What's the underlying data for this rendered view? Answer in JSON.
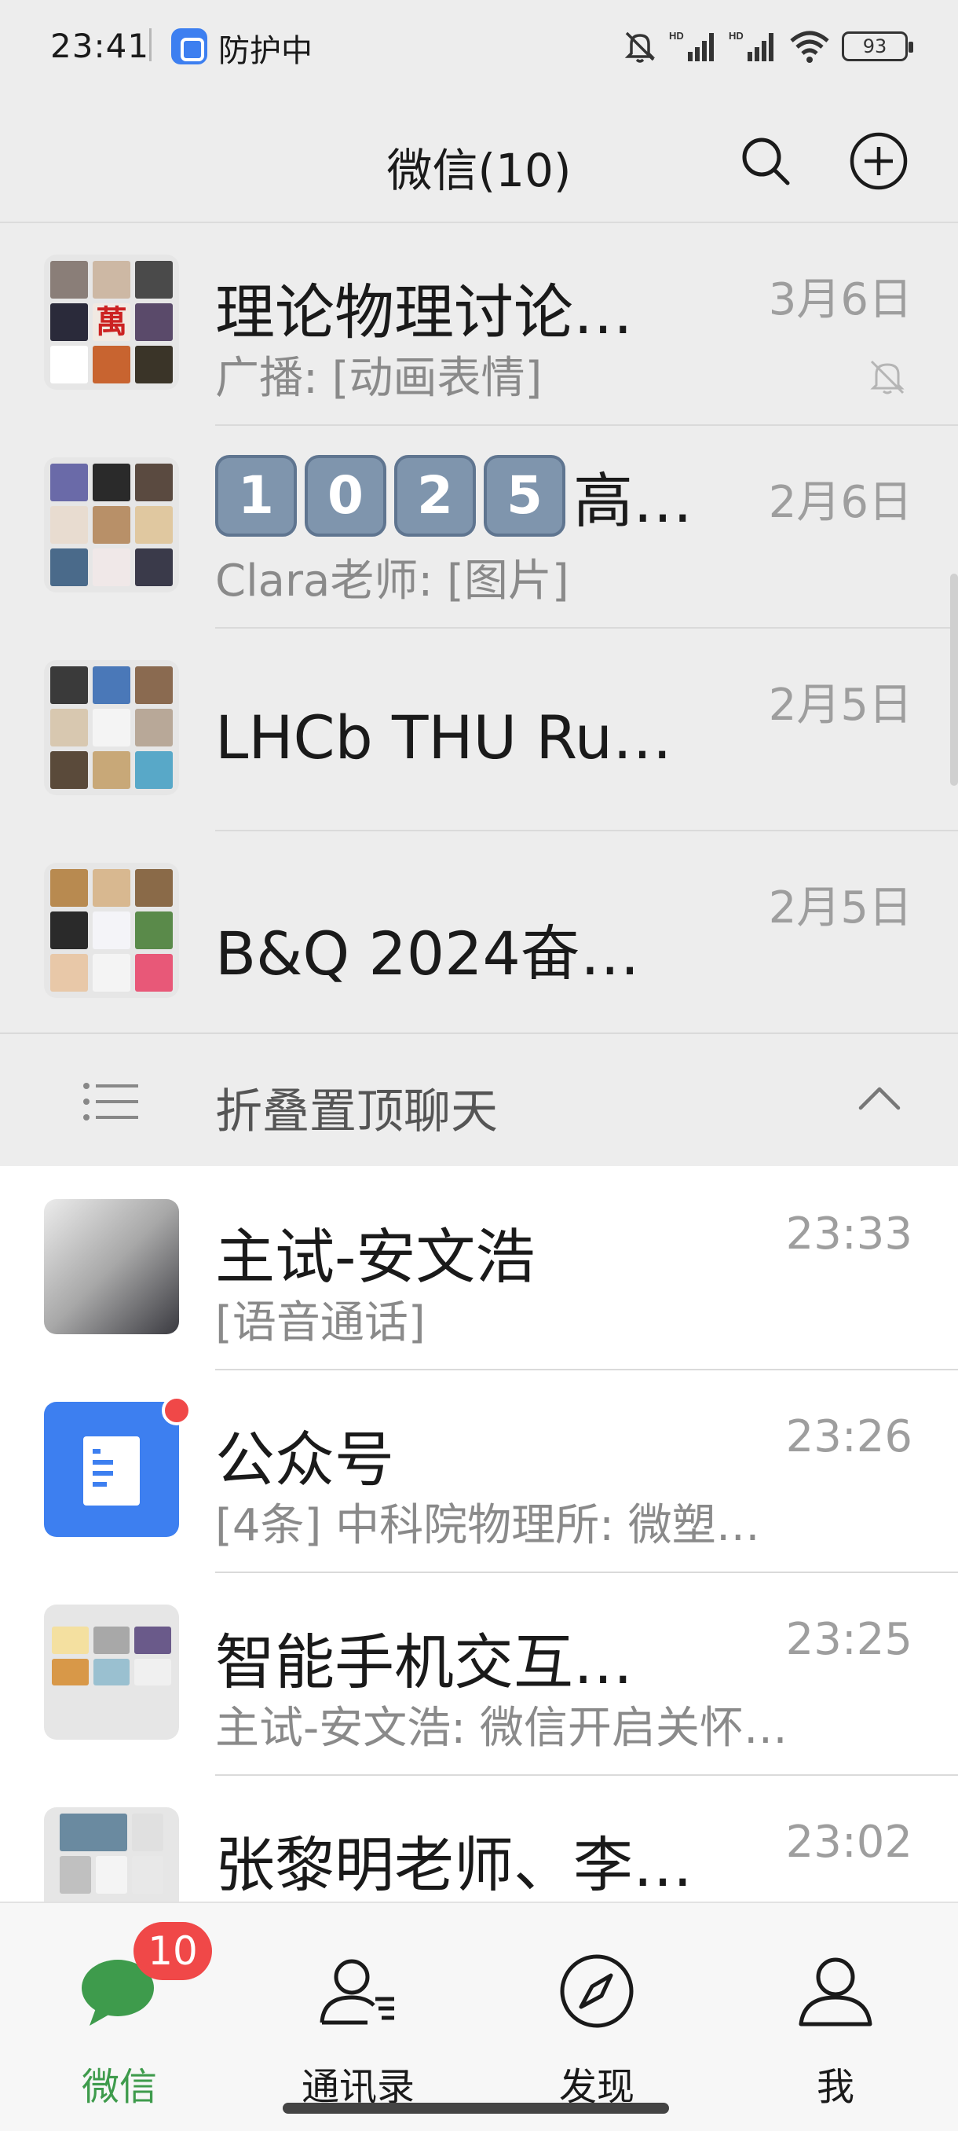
{
  "status_bar": {
    "time": "23:41",
    "protection": "防护中",
    "battery": "93"
  },
  "header": {
    "title": "微信(10)"
  },
  "pinned_chats": [
    {
      "name": "理论物理讨论…",
      "preview": "广播: [动画表情]",
      "time": "3月6日",
      "muted": true
    },
    {
      "name_keycaps": [
        "1",
        "0",
        "2",
        "5"
      ],
      "name_suffix": "高…",
      "preview": "Clara老师: [图片]",
      "time": "2月6日"
    },
    {
      "name": "LHCb THU Ru…",
      "preview": "",
      "time": "2月5日"
    },
    {
      "name": "B&Q 2024奋…",
      "preview": "",
      "time": "2月5日"
    }
  ],
  "fold_bar": {
    "label": "折叠置顶聊天"
  },
  "chats": [
    {
      "name": "主试-安文浩",
      "preview": "[语音通话]",
      "time": "23:33"
    },
    {
      "name": "公众号",
      "preview": "[4条] 中科院物理所: 微塑…",
      "time": "23:26",
      "unread_dot": true
    },
    {
      "name": "智能手机交互…",
      "preview": "主试-安文浩: 微信开启关怀…",
      "time": "23:25"
    },
    {
      "name": "张黎明老师、李…",
      "preview": "",
      "time": "23:02"
    }
  ],
  "tabbar": {
    "tabs": [
      {
        "label": "微信",
        "icon": "chat-bubble-icon",
        "active": true
      },
      {
        "label": "通讯录",
        "icon": "contacts-icon"
      },
      {
        "label": "发现",
        "icon": "compass-icon"
      },
      {
        "label": "我",
        "icon": "person-icon"
      }
    ],
    "badge": "10"
  },
  "colors": {
    "accent_green": "#3e9b4c",
    "badge_red": "#f04848",
    "gzh_blue": "#3d7ff0"
  }
}
